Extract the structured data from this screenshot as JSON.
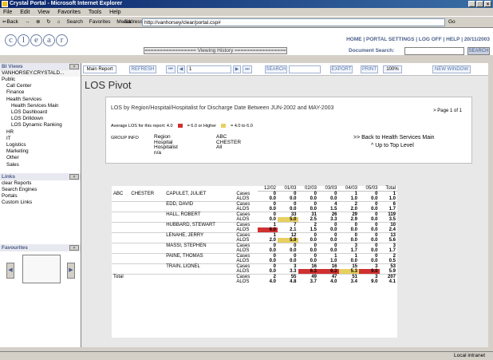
{
  "window": {
    "title": "Crystal Portal - Microsoft Internet Explorer"
  },
  "menu": [
    "File",
    "Edit",
    "View",
    "Favorites",
    "Tools",
    "Help"
  ],
  "toolbar": {
    "back": "⇐Back",
    "search": "Search",
    "favorites": "Favorites",
    "media": "Media"
  },
  "address": {
    "label": "Address",
    "url": "http://vanhorsey/clear/portal.csp#",
    "go": "Go"
  },
  "brand": {
    "logo": [
      "c",
      "l",
      "e",
      "a",
      "r"
    ]
  },
  "toplinks": "HOME | PORTAL SETTINGS | LOG OFF | HELP | 20/11/2003",
  "history": "================= Viewing History =================",
  "docsearch": {
    "label": "Document Search:",
    "button": "SEARCH"
  },
  "left": {
    "views_title": "BI Views",
    "server": "VANHORSEY.CRYSTALD...",
    "tree": [
      {
        "label": "Public",
        "lvl": 0
      },
      {
        "label": "Call Center",
        "lvl": 1
      },
      {
        "label": "Finance",
        "lvl": 1
      },
      {
        "label": "Health Services",
        "lvl": 1
      },
      {
        "label": "Health Services Main",
        "lvl": 2
      },
      {
        "label": "LOS Dashboard",
        "lvl": 2
      },
      {
        "label": "LOS Drilldown",
        "lvl": 2
      },
      {
        "label": "LOS Dynamic Ranking",
        "lvl": 2
      },
      {
        "label": "HR",
        "lvl": 1
      },
      {
        "label": "IT",
        "lvl": 1
      },
      {
        "label": "Logistics",
        "lvl": 1
      },
      {
        "label": "Marketing",
        "lvl": 1
      },
      {
        "label": "Other",
        "lvl": 1
      },
      {
        "label": "Sales",
        "lvl": 1
      }
    ],
    "links_title": "Links",
    "links": [
      "clear Reports",
      "Search Engines",
      "Portals",
      "Custom Links"
    ],
    "fav_title": "Favourites"
  },
  "reporttoolbar": {
    "type": "Main Report",
    "refresh": "REFRESH",
    "page": "1",
    "search": "SEARCH",
    "export": "EXPORT",
    "print": "PRINT",
    "zoom": "100%",
    "newwin": "NEW WINDOW"
  },
  "report": {
    "title": "LOS Pivot",
    "pageinfo": "> Page 1 of 1",
    "subtitle": "LOS by Region/Hospital/Hospitalist for Discharge Date Between JUN-2002 and MAY-2003",
    "avg": "Average LOS for this report: 4.0",
    "legend_red": "= 6.0 or Higher",
    "legend_yellow": "= 4.0 to 6.0",
    "group_info": "GROUP INFO",
    "groups": [
      "Region",
      "Hospital",
      "Hospitalist",
      "n/a"
    ],
    "group_vals": [
      "ABC",
      "CHESTER",
      "All",
      ""
    ],
    "back_main": ">> Back to Health Services Main",
    "up_top": "^ Up to Top Level",
    "cols": [
      "12/02",
      "01/03",
      "02/03",
      "03/03",
      "04/03",
      "05/03",
      "Total"
    ],
    "region": "ABC",
    "hospital": "CHESTER",
    "rows": [
      {
        "name": "CAPULET, JULIET",
        "cases": [
          "0",
          "0",
          "0",
          "0",
          "1",
          "0",
          "1"
        ],
        "alos": [
          "0.0",
          "0.0",
          "0.0",
          "0.0",
          "1.0",
          "0.0",
          "1.0"
        ],
        "hl": [
          "",
          "",
          "",
          "",
          "",
          "",
          ""
        ]
      },
      {
        "name": "EDD, DAVID",
        "cases": [
          "0",
          "0",
          "0",
          "4",
          "2",
          "0",
          "6"
        ],
        "alos": [
          "0.0",
          "0.0",
          "0.0",
          "1.5",
          "2.0",
          "0.0",
          "1.7"
        ],
        "hl": [
          "",
          "",
          "",
          "",
          "",
          "",
          ""
        ]
      },
      {
        "name": "HALL, ROBERT",
        "cases": [
          "0",
          "33",
          "31",
          "26",
          "29",
          "0",
          "119"
        ],
        "alos": [
          "0.0",
          "5.0",
          "2.5",
          "3.3",
          "2.9",
          "0.0",
          "3.5"
        ],
        "hl": [
          "",
          "y",
          "",
          "",
          "",
          "",
          ""
        ]
      },
      {
        "name": "HUBBARD, STEWART",
        "cases": [
          "1",
          "7",
          "2",
          "0",
          "0",
          "0",
          "10"
        ],
        "alos": [
          "6.0",
          "2.1",
          "1.5",
          "0.0",
          "0.0",
          "0.0",
          "2.4"
        ],
        "hl": [
          "r",
          "",
          "",
          "",
          "",
          "",
          ""
        ]
      },
      {
        "name": "LENAHE, JERRY",
        "cases": [
          "1",
          "12",
          "0",
          "0",
          "0",
          "0",
          "13"
        ],
        "alos": [
          "2.0",
          "5.9",
          "0.0",
          "0.0",
          "0.0",
          "0.0",
          "5.6"
        ],
        "hl": [
          "",
          "y",
          "",
          "",
          "",
          "",
          ""
        ]
      },
      {
        "name": "MASSI, STEPHEN",
        "cases": [
          "0",
          "0",
          "0",
          "0",
          "3",
          "0",
          "3"
        ],
        "alos": [
          "0.0",
          "0.0",
          "0.0",
          "0.0",
          "1.7",
          "0.0",
          "1.7"
        ],
        "hl": [
          "",
          "",
          "",
          "",
          "",
          "",
          ""
        ]
      },
      {
        "name": "PAINE, THOMAS",
        "cases": [
          "0",
          "0",
          "0",
          "1",
          "1",
          "0",
          "2"
        ],
        "alos": [
          "0.0",
          "0.0",
          "0.0",
          "1.0",
          "0.0",
          "0.0",
          "0.5"
        ],
        "hl": [
          "",
          "",
          "",
          "",
          "",
          "",
          ""
        ]
      },
      {
        "name": "TRAIN, LIONEL",
        "cases": [
          "0",
          "3",
          "16",
          "16",
          "15",
          "3",
          "53"
        ],
        "alos": [
          "0.0",
          "3.3",
          "6.3",
          "6.3",
          "5.3",
          "9.0",
          "5.9"
        ],
        "hl": [
          "",
          "",
          "r",
          "r",
          "y",
          "r",
          ""
        ]
      }
    ],
    "total_label": "Total",
    "total_cases": [
      "2",
      "55",
      "49",
      "47",
      "51",
      "3",
      "207"
    ],
    "total_alos": [
      "4.0",
      "4.8",
      "3.7",
      "4.0",
      "3.4",
      "9.0",
      "4.1"
    ],
    "cases_label": "Cases",
    "alos_label": "ALOS"
  },
  "status": {
    "zone": "Local intranet"
  }
}
